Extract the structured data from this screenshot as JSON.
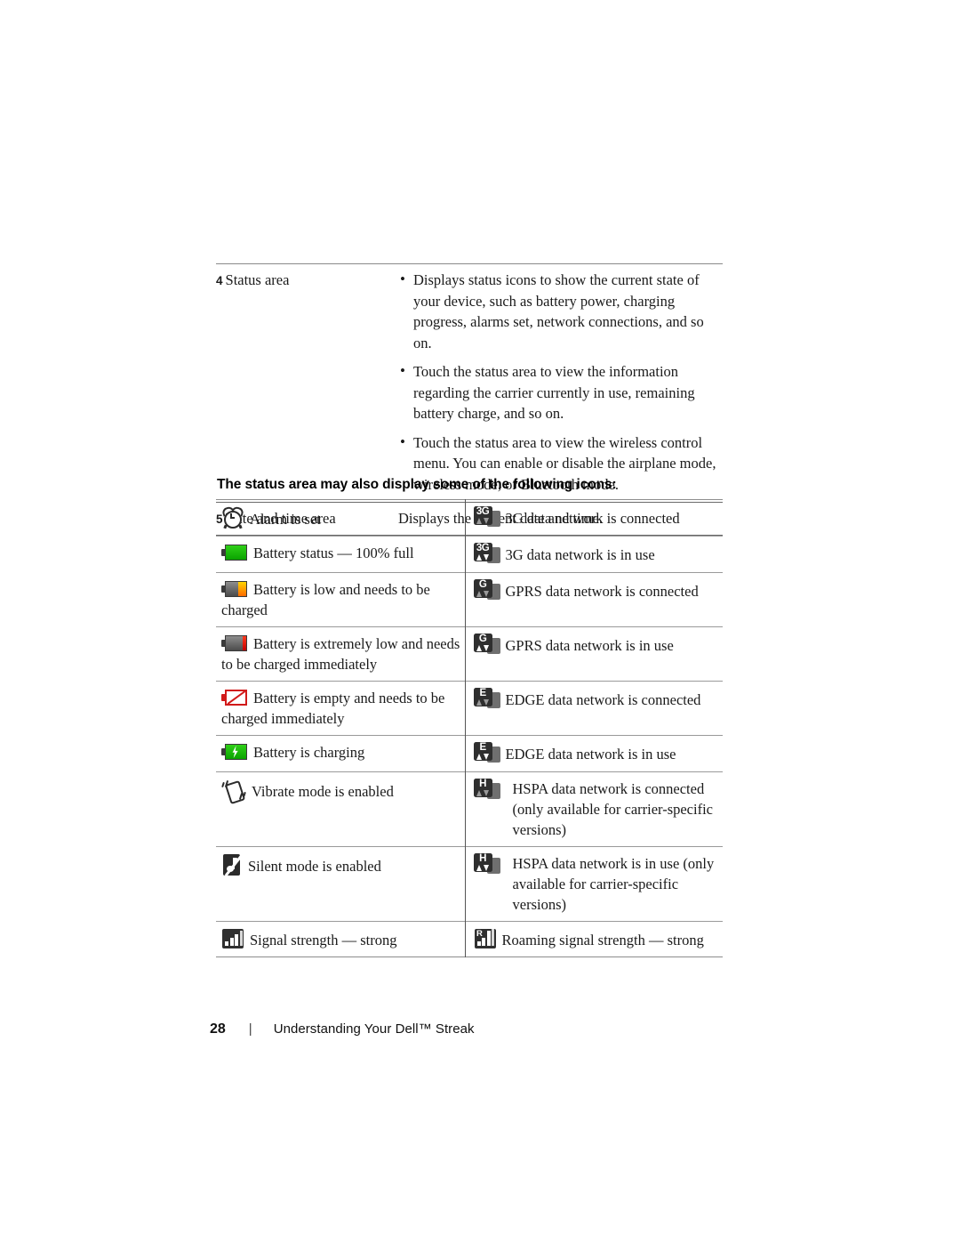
{
  "document": {
    "footer": {
      "page_number": "28",
      "separator": "|",
      "breadcrumb": "Understanding Your Dell™ Streak"
    }
  },
  "description_table": {
    "rows": [
      {
        "number": "4",
        "label": "Status area",
        "bullets": [
          "Displays status icons to show the current state of your device, such as battery power, charging progress, alarms set, network connections, and so on.",
          "Touch the status area to view the information regarding the carrier currently in use, remaining battery charge, and so on.",
          "Touch the status area to view the wireless control menu. You can enable or disable the airplane mode, wireless mode, or Bluetooth mode."
        ]
      },
      {
        "number": "5",
        "label": "Date and time area",
        "description": "Displays the current date and time."
      }
    ]
  },
  "section": {
    "heading": "The status area may also display some of the following icons:"
  },
  "icon_table": {
    "rows": [
      {
        "left": {
          "icon": "alarm-clock-icon",
          "text": "Alarm is set"
        },
        "right": {
          "icon": "3g-connected-icon",
          "text": "3G data network is connected"
        }
      },
      {
        "left": {
          "icon": "battery-full-icon",
          "text": "Battery status — 100% full"
        },
        "right": {
          "icon": "3g-in-use-icon",
          "text": "3G data network is in use"
        }
      },
      {
        "left": {
          "icon": "battery-low-icon",
          "text": "Battery is low and needs to be charged"
        },
        "right": {
          "icon": "gprs-connected-icon",
          "text": "GPRS data network is connected"
        }
      },
      {
        "left": {
          "icon": "battery-critical-icon",
          "text": "Battery is extremely low and needs to be charged immediately"
        },
        "right": {
          "icon": "gprs-in-use-icon",
          "text": "GPRS data network is in use"
        }
      },
      {
        "left": {
          "icon": "battery-empty-icon",
          "text": "Battery is empty and needs to be charged immediately"
        },
        "right": {
          "icon": "edge-connected-icon",
          "text": "EDGE data network is connected"
        }
      },
      {
        "left": {
          "icon": "battery-charging-icon",
          "text": "Battery is charging"
        },
        "right": {
          "icon": "edge-in-use-icon",
          "text": "EDGE data network is in use"
        }
      },
      {
        "left": {
          "icon": "vibrate-mode-icon",
          "text": "Vibrate mode is enabled"
        },
        "right": {
          "icon": "hspa-connected-icon",
          "text": "HSPA data network is connected (only available for carrier-specific versions)"
        }
      },
      {
        "left": {
          "icon": "silent-mode-icon",
          "text": "Silent mode is enabled"
        },
        "right": {
          "icon": "hspa-in-use-icon",
          "text": "HSPA data network is in use (only available for carrier-specific versions)"
        }
      },
      {
        "left": {
          "icon": "signal-strength-icon",
          "text": "Signal strength — strong"
        },
        "right": {
          "icon": "roaming-signal-strength-icon",
          "text": "Roaming signal strength — strong"
        }
      }
    ],
    "network_labels": {
      "three_g": "3G",
      "gprs": "G",
      "edge": "E",
      "hspa": "H",
      "roaming": "R"
    }
  },
  "colors": {
    "battery_full": "#0aa300",
    "battery_low": "#ff6a00",
    "battery_critical": "#c40000",
    "battery_empty": "#d11a1a",
    "icon_dark": "#2f2f2f",
    "rule": "#8d8d8d"
  }
}
